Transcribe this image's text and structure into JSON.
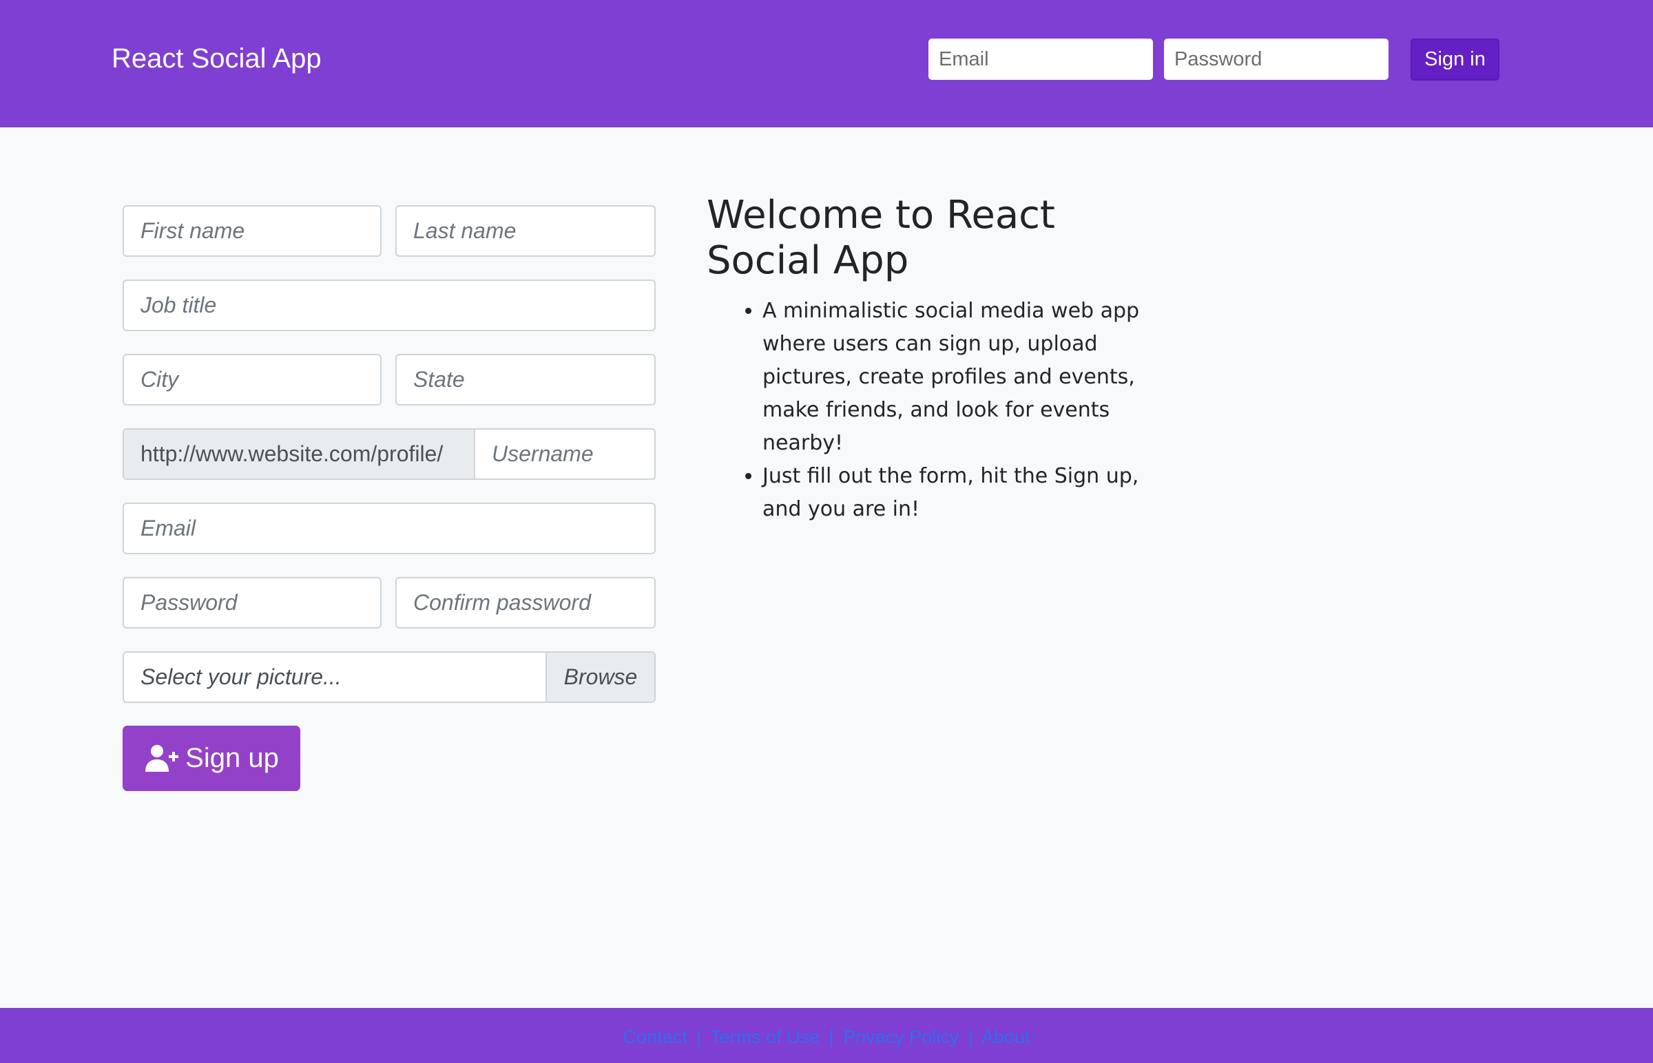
{
  "header": {
    "brand": "React Social App",
    "email_placeholder": "Email",
    "password_placeholder": "Password",
    "signin_label": "Sign in"
  },
  "form": {
    "first_name_placeholder": "First name",
    "last_name_placeholder": "Last name",
    "job_title_placeholder": "Job title",
    "city_placeholder": "City",
    "state_placeholder": "State",
    "profile_url_prefix": "http://www.website.com/profile/",
    "username_placeholder": "Username",
    "email_placeholder": "Email",
    "password_placeholder": "Password",
    "confirm_password_placeholder": "Confirm password",
    "picture_placeholder": "Select your picture...",
    "browse_label": "Browse",
    "signup_label": "Sign up",
    "signup_icon": "user-plus-icon"
  },
  "welcome": {
    "title": "Welcome to React Social App",
    "bullets": [
      "A minimalistic social media web app where users can sign up, upload pictures, create profiles and events, make friends, and look for events nearby!",
      "Just fill out the form, hit the Sign up, and you are in!"
    ]
  },
  "footer": {
    "links": [
      "Contact",
      "Terms of Use",
      "Privacy Policy",
      "About"
    ],
    "separator": "|"
  },
  "colors": {
    "brand_purple": "#7e3fd2",
    "signin_button": "#6420c4",
    "signup_button": "#9341c9",
    "footer_link": "#2f6ef0",
    "page_background": "#f8f9fa"
  }
}
